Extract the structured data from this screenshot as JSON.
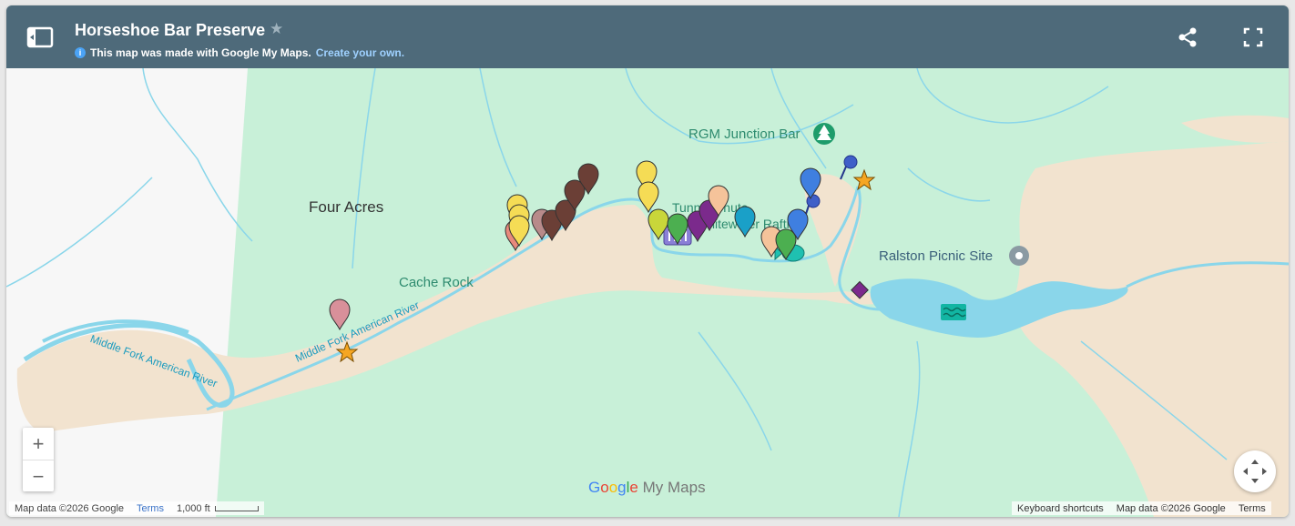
{
  "header": {
    "title": "Horseshoe Bar Preserve",
    "subtitle_text": "This map was made with Google My Maps.",
    "create_link": "Create your own."
  },
  "map": {
    "labels": {
      "four_acres": "Four Acres",
      "cache_rock": "Cache Rock",
      "rgm_junction": "RGM Junction Bar",
      "ralston": "Ralston Picnic Site",
      "river_1": "Middle Fork American River",
      "river_2": "Middle Fork American River",
      "tunnel": "Tunnel Chute",
      "water": "Whitewater Rafting"
    },
    "zoom_in": "+",
    "zoom_out": "−",
    "brand": "Google My Maps",
    "attribution_left": {
      "map_data": "Map data ©2026 Google",
      "terms": "Terms",
      "scale": "1,000 ft"
    },
    "attribution_right": {
      "shortcuts": "Keyboard shortcuts",
      "map_data": "Map data ©2026 Google",
      "terms": "Terms"
    },
    "colors": {
      "park": "#c8f0d8",
      "sand": "#f2e3cf",
      "water": "#8ad6ea",
      "header": "#4e6a7a"
    },
    "pins": [
      {
        "name": "pin-salmon",
        "color": "#e8897c"
      },
      {
        "name": "pin-yellow",
        "color": "#f5dc55"
      },
      {
        "name": "pin-mauve",
        "color": "#b88a8a"
      },
      {
        "name": "pin-brown",
        "color": "#6b3f36"
      },
      {
        "name": "pin-lime",
        "color": "#c9d63a"
      },
      {
        "name": "pin-green",
        "color": "#4caf50"
      },
      {
        "name": "pin-purple",
        "color": "#7b2a8c"
      },
      {
        "name": "pin-peach",
        "color": "#f5c39a"
      },
      {
        "name": "pin-cyan",
        "color": "#1aa0c8"
      },
      {
        "name": "pin-blue",
        "color": "#3f7fe0"
      },
      {
        "name": "pin-pink",
        "color": "#d8909a"
      },
      {
        "name": "pin-teal",
        "color": "#1fc0b0"
      }
    ],
    "icons": [
      "star-icon",
      "pushpin-icon",
      "diamond-icon",
      "waves-icon",
      "building-icon",
      "fish-icon",
      "tree-icon",
      "place-icon"
    ]
  }
}
